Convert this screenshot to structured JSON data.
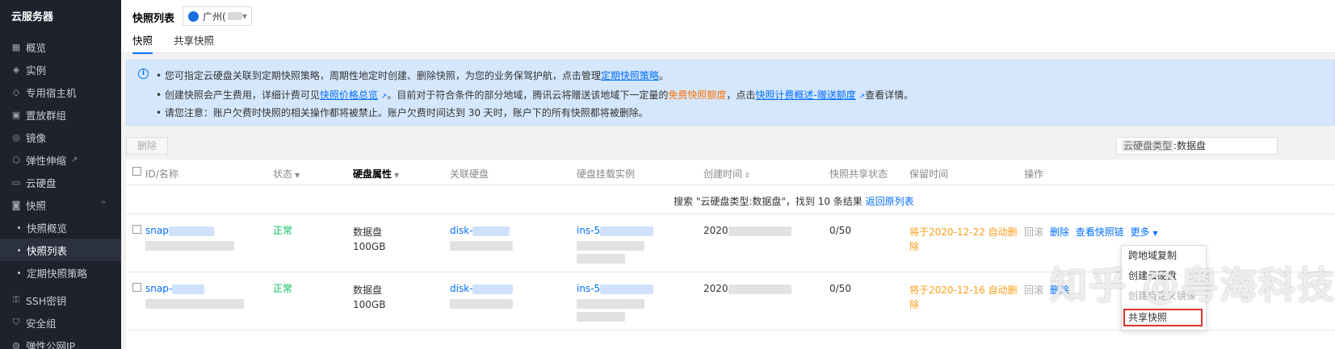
{
  "sidebar": {
    "title": "云服务器",
    "items": [
      {
        "label": "概览",
        "icon": "grid-icon"
      },
      {
        "label": "实例",
        "icon": "cube-icon"
      },
      {
        "label": "专用宿主机",
        "icon": "layers-icon"
      },
      {
        "label": "置放群组",
        "icon": "group-icon"
      },
      {
        "label": "镜像",
        "icon": "disc-icon"
      },
      {
        "label": "弹性伸缩",
        "icon": "scale-icon",
        "external": "↗"
      },
      {
        "label": "云硬盘",
        "icon": "disk-icon"
      },
      {
        "label": "快照",
        "icon": "camera-icon",
        "chevron": "^"
      }
    ],
    "sub_items": [
      "快照概览",
      "快照列表",
      "定期快照策略"
    ],
    "items_after": [
      {
        "label": "SSH密钥",
        "icon": "key-icon"
      },
      {
        "label": "安全组",
        "icon": "shield-icon"
      },
      {
        "label": "弹性公网IP",
        "icon": "ip-icon"
      }
    ]
  },
  "header": {
    "title": "快照列表",
    "region": "广州(",
    "tabs": [
      "快照",
      "共享快照"
    ]
  },
  "notice": {
    "line1": {
      "bullet": "•",
      "text": "您可指定云硬盘关联到定期快照策略，周期性地定时创建、删除快照，为您的业务保驾护航，点击管理",
      "link": "定期快照策略",
      "end": "。"
    },
    "line2": {
      "bullet": "•",
      "t1": "创建快照会产生费用，详细计费可见",
      "link1": "快照价格总览",
      "t2": "。目前对于符合条件的部分地域，腾讯云将赠送该地域下一定量的",
      "orange": "免费快照额度",
      "t3": "，点击",
      "link2": "快照计费概述-赠送额度",
      "t4": "查看详情。"
    },
    "line3": {
      "bullet": "•",
      "text": "请您注意：账户欠费时快照的相关操作都将被禁止。账户欠费时间达到 30 天时，账户下的所有快照都将被删除。"
    }
  },
  "toolbar": {
    "delete_label": "删除",
    "filter_tag": "云硬盘类型",
    "filter_value": ":数据盘"
  },
  "table": {
    "headers": {
      "id": "ID/名称",
      "status": "状态",
      "disk_attr": "硬盘属性",
      "linked_disk": "关联硬盘",
      "instance": "硬盘挂载实例",
      "created": "创建时间",
      "share": "快照共享状态",
      "retain": "保留时间",
      "ops": "操作"
    },
    "sort_icon": "▼",
    "sort2_icon": "⇕",
    "result_text": "搜索 \"云硬盘类型:数据盘\"，找到 10 条结果",
    "result_link": "返回原列表",
    "rows": [
      {
        "id": "snap",
        "status": "正常",
        "disk_type": "数据盘",
        "disk_size": "100GB",
        "linked_disk": "disk-",
        "instance": "ins-5",
        "created": "2020",
        "share": "0/50",
        "retain1": "将于2020-12-22 自动删",
        "retain2": "除",
        "ops": [
          "回滚",
          "删除",
          "查看快照链",
          "更多"
        ]
      },
      {
        "id": "snap-",
        "status": "正常",
        "disk_type": "数据盘",
        "disk_size": "100GB",
        "linked_disk": "disk-",
        "instance": "ins-5",
        "created": "2020",
        "share": "0/50",
        "retain1": "将于2020-12-16 自动删",
        "retain2": "除",
        "ops": [
          "回滚",
          "删除"
        ]
      }
    ]
  },
  "more_menu": [
    "跨地域复制",
    "创建云硬盘",
    "创建自定义镜像",
    "共享快照"
  ],
  "watermark": "知乎 @粤海科技君"
}
